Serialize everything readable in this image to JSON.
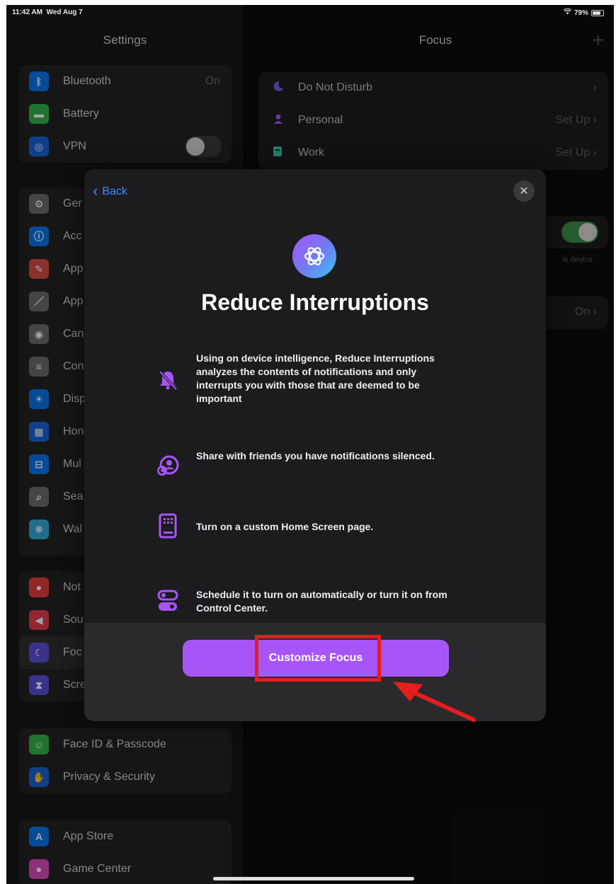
{
  "status_bar": {
    "time": "11:42 AM",
    "date": "Wed Aug 7",
    "battery": "79%"
  },
  "settings": {
    "title": "Settings",
    "groups": [
      {
        "rows": [
          {
            "label": "Bluetooth",
            "value": "On",
            "icon": "bluetooth-icon",
            "color": "#0a74e8"
          },
          {
            "label": "Battery",
            "value": "",
            "icon": "battery-icon",
            "color": "#34b34a"
          },
          {
            "label": "VPN",
            "value": "",
            "icon": "vpn-icon",
            "color": "#1a63d6"
          }
        ]
      },
      {
        "rows": [
          {
            "label": "Ger",
            "icon": "general-icon",
            "color": "#6b6b6b"
          },
          {
            "label": "Acc",
            "icon": "accessibility-icon",
            "color": "#0a74e8"
          },
          {
            "label": "App",
            "icon": "apple-pencil-icon",
            "color": "#d84a43"
          },
          {
            "label": "App",
            "icon": "pencil-icon",
            "color": "#6b6b6b"
          },
          {
            "label": "Can",
            "icon": "camera-icon",
            "color": "#6b6b6b"
          },
          {
            "label": "Con",
            "icon": "control-center-icon",
            "color": "#6b6b6b"
          },
          {
            "label": "Disp",
            "icon": "display-icon",
            "color": "#0a74e8"
          },
          {
            "label": "Hon",
            "icon": "home-screen-icon",
            "color": "#1a63d6"
          },
          {
            "label": "Mul",
            "icon": "multitasking-icon",
            "color": "#0a74e8"
          },
          {
            "label": "Sea",
            "icon": "search-icon",
            "color": "#6b6b6b"
          },
          {
            "label": "Wal",
            "icon": "wallpaper-icon",
            "color": "#34a8d6"
          }
        ]
      },
      {
        "rows": [
          {
            "label": "Not",
            "icon": "notifications-icon",
            "color": "#e23b3b"
          },
          {
            "label": "Sou",
            "icon": "sounds-icon",
            "color": "#e23b52"
          },
          {
            "label": "Foc",
            "icon": "focus-icon",
            "color": "#5a4fd6",
            "selected": true
          },
          {
            "label": "Scre",
            "icon": "screen-time-icon",
            "color": "#5a4fd6"
          }
        ]
      },
      {
        "rows": [
          {
            "label": "Face ID & Passcode",
            "icon": "face-id-icon",
            "color": "#34b34a"
          },
          {
            "label": "Privacy & Security",
            "icon": "privacy-hand-icon",
            "color": "#1a63d6"
          }
        ]
      },
      {
        "rows": [
          {
            "label": "App Store",
            "icon": "app-store-icon",
            "color": "#0a74e8"
          },
          {
            "label": "Game Center",
            "icon": "game-center-icon",
            "color": "#d84ac0"
          }
        ]
      }
    ]
  },
  "focus_pane": {
    "title": "Focus",
    "items": [
      {
        "label": "Do Not Disturb",
        "value": "",
        "icon": "moon-icon",
        "color": "#6f5ce0"
      },
      {
        "label": "Personal",
        "value": "Set Up",
        "icon": "person-icon",
        "color": "#a855f7"
      },
      {
        "label": "Work",
        "value": "Set Up",
        "icon": "badge-icon",
        "color": "#34c0a0"
      }
    ],
    "share_note": "is device",
    "filter_value": "On"
  },
  "modal": {
    "back_label": "Back",
    "title": "Reduce Interruptions",
    "features": [
      {
        "icon": "bell-slash-icon",
        "text": "Using on device intelligence, Reduce Interruptions analyzes the contents of notifications and only interrupts you with those that are deemed to be important"
      },
      {
        "icon": "shared-status-icon",
        "text": "Share with friends you have notifications silenced."
      },
      {
        "icon": "home-page-icon",
        "text": "Turn on a custom Home Screen page."
      },
      {
        "icon": "schedule-toggle-icon",
        "text": "Schedule it to turn on automatically or turn it on from Control Center."
      }
    ],
    "cta_label": "Customize Focus",
    "accent": "#a855f7",
    "annotation_color": "#e51d1d"
  }
}
